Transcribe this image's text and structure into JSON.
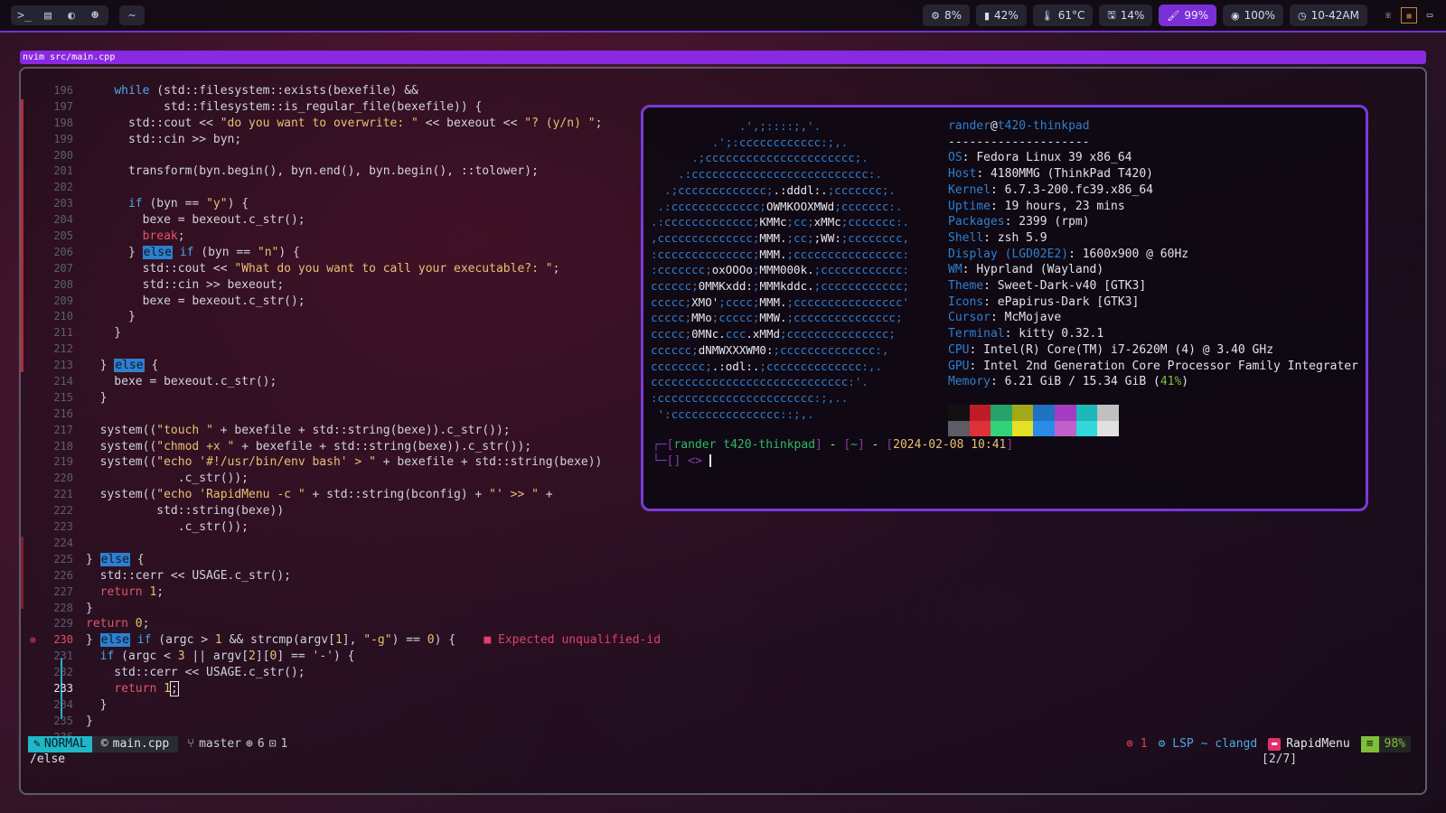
{
  "topbar": {
    "left_icons": [
      "terminal-icon",
      "document-icon",
      "fedora-icon",
      "discord-icon",
      "home-icon"
    ],
    "home_label": "~",
    "stats": [
      {
        "icon": "cpu-icon",
        "glyph": "⚙",
        "value": "8%"
      },
      {
        "icon": "battery-icon",
        "glyph": "▮",
        "value": "42%"
      },
      {
        "icon": "thermometer-icon",
        "glyph": "🌡",
        "value": "61°C"
      },
      {
        "icon": "disk-icon",
        "glyph": "🖫",
        "value": "14%"
      },
      {
        "icon": "brightness-icon",
        "glyph": "🖌",
        "value": "99%"
      },
      {
        "icon": "volume-icon",
        "glyph": "◉",
        "value": "100%"
      },
      {
        "icon": "clock-icon",
        "glyph": "◷",
        "value": "10-42AM"
      }
    ]
  },
  "window": {
    "title": "nvim src/main.cpp"
  },
  "editor": {
    "diagnostic": "Expected unqualified-id",
    "statusline": {
      "mode": "NORMAL",
      "file": "main.cpp",
      "branch": "master",
      "added": "6",
      "modified": "1",
      "errors": "1",
      "lsp": "LSP ~ clangd",
      "project": "RapidMenu",
      "percent": "98%"
    },
    "cmdline": "/else",
    "search_count": "[2/7]"
  },
  "terminal": {
    "user": "rander",
    "at": "@",
    "host": "t420-thinkpad",
    "separator": "--------------------",
    "info": [
      {
        "key": "OS",
        "value": "Fedora Linux 39 x86_64"
      },
      {
        "key": "Host",
        "value": "4180MMG (ThinkPad T420)"
      },
      {
        "key": "Kernel",
        "value": "6.7.3-200.fc39.x86_64"
      },
      {
        "key": "Uptime",
        "value": "19 hours, 23 mins"
      },
      {
        "key": "Packages",
        "value": "2399 (rpm)"
      },
      {
        "key": "Shell",
        "value": "zsh 5.9"
      },
      {
        "key": "Display (LGD02E2)",
        "value": "1600x900 @ 60Hz"
      },
      {
        "key": "WM",
        "value": "Hyprland (Wayland)"
      },
      {
        "key": "Theme",
        "value": "Sweet-Dark-v40 [GTK3]"
      },
      {
        "key": "Icons",
        "value": "ePapirus-Dark [GTK3]"
      },
      {
        "key": "Cursor",
        "value": "McMojave"
      },
      {
        "key": "Terminal",
        "value": "kitty 0.32.1"
      },
      {
        "key": "CPU",
        "value": "Intel(R) Core(TM) i7-2620M (4) @ 3.40 GHz"
      },
      {
        "key": "GPU",
        "value": "Intel 2nd Generation Core Processor Family Integrater"
      },
      {
        "key": "Memory",
        "value": "6.21 GiB / 15.34 GiB ("
      }
    ],
    "memory_pct": "41%",
    "memory_tail": ")",
    "palette": [
      "#111111",
      "#c01c28",
      "#26a269",
      "#a2a817",
      "#1e72c0",
      "#a33cc0",
      "#1fb8b8",
      "#c0c0c0",
      "#5e5c64",
      "#e0303a",
      "#33d17a",
      "#e5e023",
      "#2a8be8",
      "#c061cb",
      "#30d8d8",
      "#e0e0e0"
    ],
    "prompt": {
      "user": "rander",
      "host": "t420-thinkpad",
      "dir": "~",
      "date": "2024-02-08 10:41"
    }
  }
}
